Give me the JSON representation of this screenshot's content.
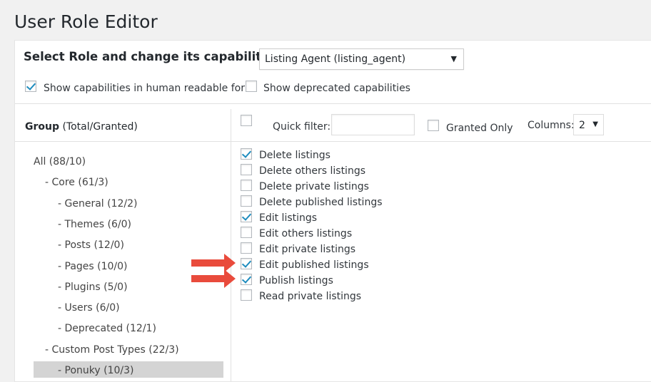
{
  "title": "User Role Editor",
  "role": {
    "label": "Select Role and change its capabilities:",
    "selected": "Listing Agent (listing_agent)"
  },
  "options": {
    "human_readable": {
      "label": "Show capabilities in human readable form",
      "checked": true
    },
    "deprecated": {
      "label": "Show deprecated capabilities",
      "checked": false
    }
  },
  "groups": {
    "header_bold": "Group",
    "header_rest": " (Total/Granted)",
    "items": [
      {
        "label": "All (88/10)",
        "level": 0
      },
      {
        "label": "- Core (61/3)",
        "level": 1
      },
      {
        "label": "- General (12/2)",
        "level": 2
      },
      {
        "label": "- Themes (6/0)",
        "level": 2
      },
      {
        "label": "- Posts (12/0)",
        "level": 2
      },
      {
        "label": "- Pages (10/0)",
        "level": 2
      },
      {
        "label": "- Plugins (5/0)",
        "level": 2
      },
      {
        "label": "- Users (6/0)",
        "level": 2
      },
      {
        "label": "- Deprecated (12/1)",
        "level": 2
      },
      {
        "label": "- Custom Post Types (22/3)",
        "level": 1
      },
      {
        "label": "- Ponuky (10/3)",
        "level": 2,
        "selected": true
      }
    ]
  },
  "toolbar": {
    "quick_filter_label": "Quick filter:",
    "quick_filter_value": "",
    "granted_only_label": "Granted Only",
    "columns_label": "Columns:",
    "columns_value": "2"
  },
  "capabilities": [
    {
      "label": "Delete listings",
      "checked": true
    },
    {
      "label": "Delete others listings",
      "checked": false
    },
    {
      "label": "Delete private listings",
      "checked": false
    },
    {
      "label": "Delete published listings",
      "checked": false
    },
    {
      "label": "Edit listings",
      "checked": true
    },
    {
      "label": "Edit others listings",
      "checked": false
    },
    {
      "label": "Edit private listings",
      "checked": false
    },
    {
      "label": "Edit published listings",
      "checked": true,
      "highlighted": true
    },
    {
      "label": "Publish listings",
      "checked": true,
      "highlighted": true
    },
    {
      "label": "Read private listings",
      "checked": false
    }
  ],
  "colors": {
    "accent": "#1e8cbe",
    "arrow": "#e94b3c",
    "selected_bg": "#d4d4d4"
  }
}
